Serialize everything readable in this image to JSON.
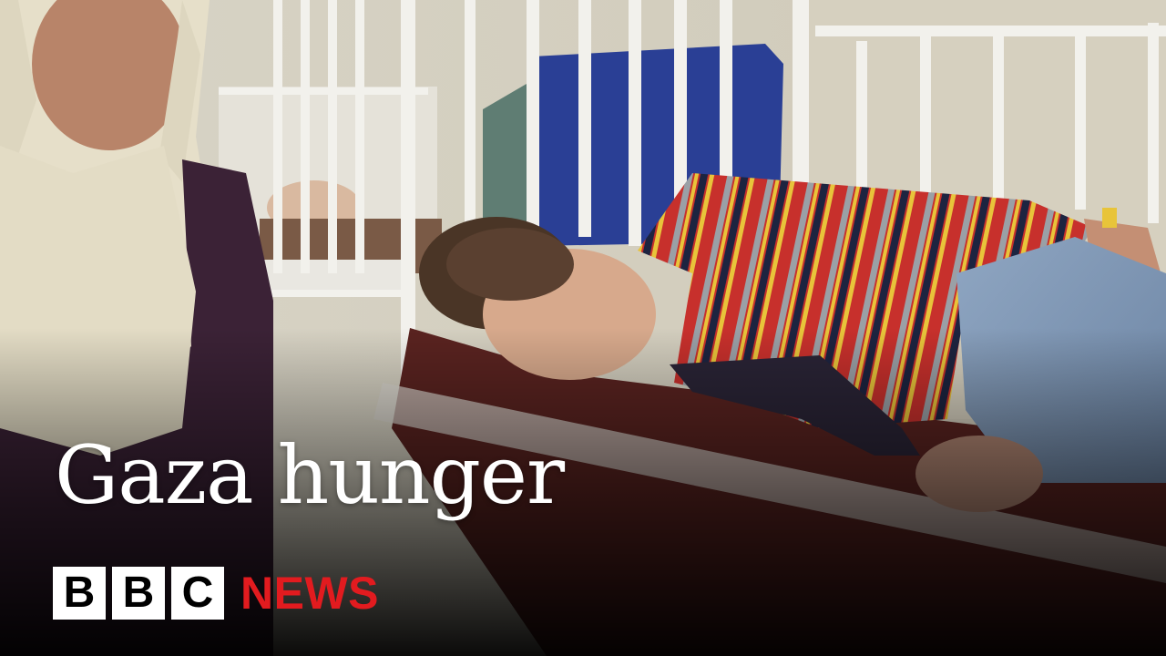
{
  "headline": "Gaza hunger",
  "brand": {
    "bbc_letters": [
      "B",
      "B",
      "C"
    ],
    "news_word": "NEWS"
  },
  "colors": {
    "headline_text": "#ffffff",
    "bbc_block_bg": "#ffffff",
    "bbc_block_text": "#000000",
    "news_red": "#e21b1f"
  }
}
